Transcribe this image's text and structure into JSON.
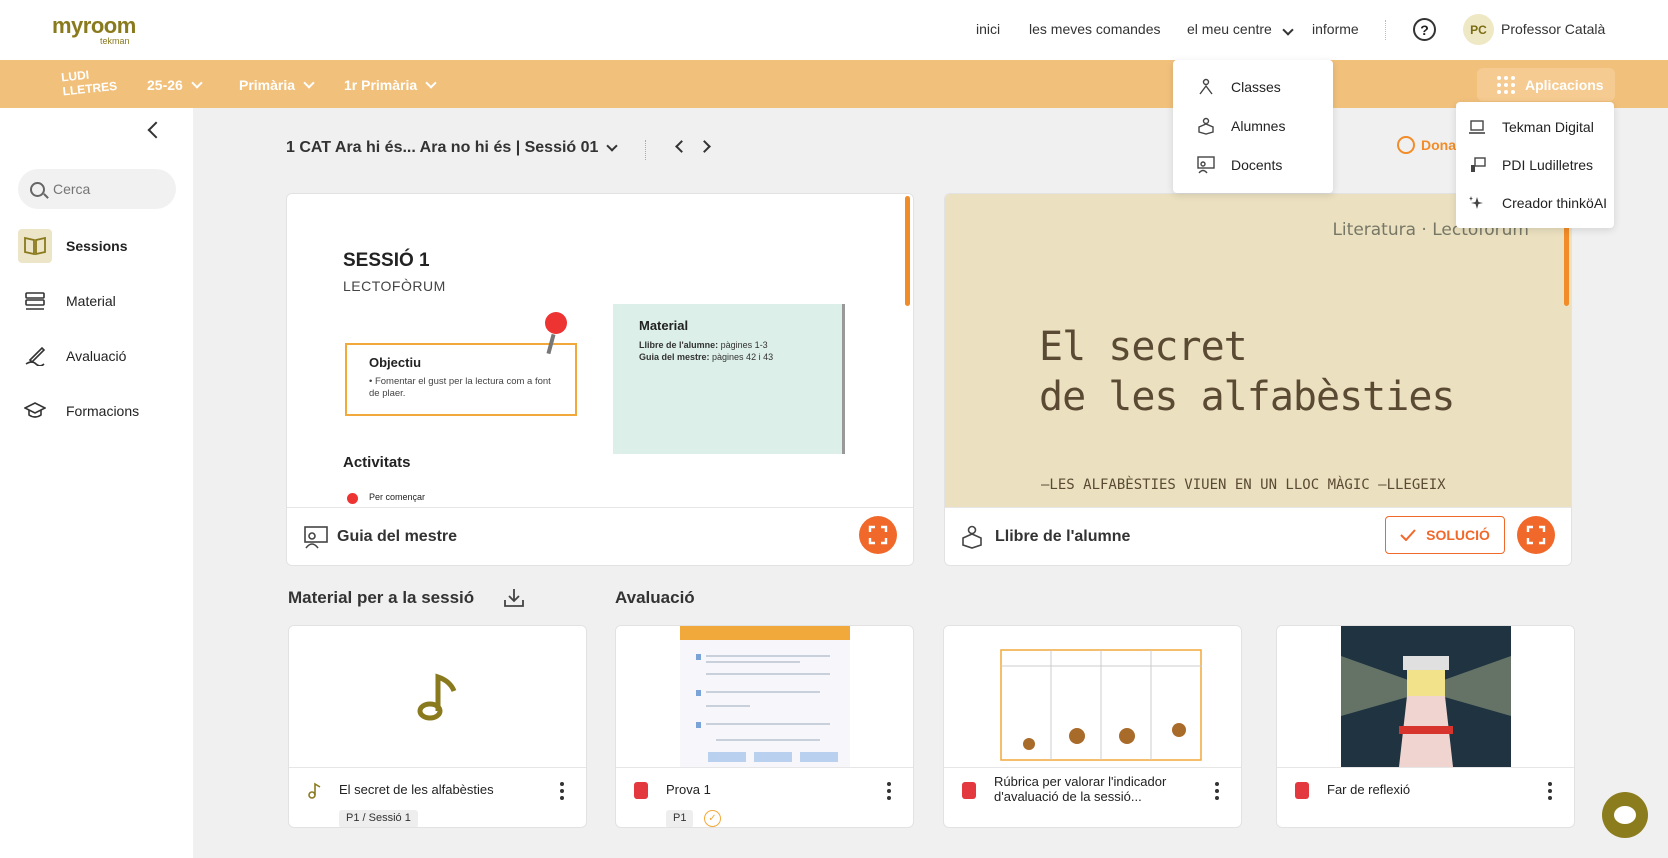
{
  "brand": {
    "logo_main": "myroom",
    "logo_sub": "tekman",
    "program_logo": "LUDI LLETRES"
  },
  "topnav": {
    "items": [
      "inici",
      "les meves comandes",
      "el meu centre",
      "informe"
    ],
    "user_initials": "PC",
    "user_name": "Professor Català"
  },
  "filters": {
    "year": "25-26",
    "stage": "Primària",
    "grade": "1r Primària"
  },
  "apps_button": "Aplicacions",
  "sidebar": {
    "search_placeholder": "Cerca",
    "items": [
      {
        "label": "Sessions",
        "icon": "book-open-icon",
        "active": true
      },
      {
        "label": "Material",
        "icon": "stack-icon",
        "active": false
      },
      {
        "label": "Avaluació",
        "icon": "pen-icon",
        "active": false
      },
      {
        "label": "Formacions",
        "icon": "graduation-cap-icon",
        "active": false
      }
    ]
  },
  "session_title": "1 CAT Ara hi és... Ara no hi és | Sessió 01",
  "feedback_link": "Dona",
  "teacher_guide": {
    "footer_label": "Guia del mestre",
    "slide": {
      "title": "SESSIÓ 1",
      "subtitle": "LECTOFÒRUM",
      "objective_heading": "Objectiu",
      "objective_text": "• Fomentar el gust per la lectura com a font de plaer.",
      "material_heading": "Material",
      "material_line1_bold": "Llibre de l'alumne:",
      "material_line1": " pàgines 1-3",
      "material_line2_bold": "Guia del mestre:",
      "material_line2": " pàgines 42 i 43",
      "activities_heading": "Activitats",
      "activity_first": "Per començar"
    }
  },
  "student_book": {
    "footer_label": "Llibre de l'alumne",
    "solution_label": "SOLUCIÓ",
    "slide": {
      "category": "Literatura · Lectofòrum",
      "title_line1": "El secret",
      "title_line2": "de les alfabèsties",
      "subtitle": "—LES ALFABÈSTIES VIUEN EN UN LLOC MÀGIC —LLEGEIX"
    }
  },
  "sections": {
    "material": "Material per a la sessió",
    "evaluation": "Avaluació"
  },
  "tiles": [
    {
      "label": "El secret de les alfabèsties",
      "chip": "P1 / Sessió 1",
      "type": "audio"
    },
    {
      "label": "Prova 1",
      "chip": "P1",
      "type": "document",
      "checked": true
    },
    {
      "label": "Rúbrica per valorar l'indicador d'avaluació de la sessió...",
      "chip": "",
      "type": "document"
    },
    {
      "label": "Far de reflexió",
      "chip": "",
      "type": "document"
    }
  ],
  "centre_menu": [
    "Classes",
    "Alumnes",
    "Docents"
  ],
  "apps_menu": [
    "Tekman Digital",
    "PDI Ludilletres",
    "Creador thinköAI"
  ],
  "colors": {
    "accent": "#f1682b",
    "orange_bar": "#f1c17c",
    "brand": "#8a7a1e"
  }
}
